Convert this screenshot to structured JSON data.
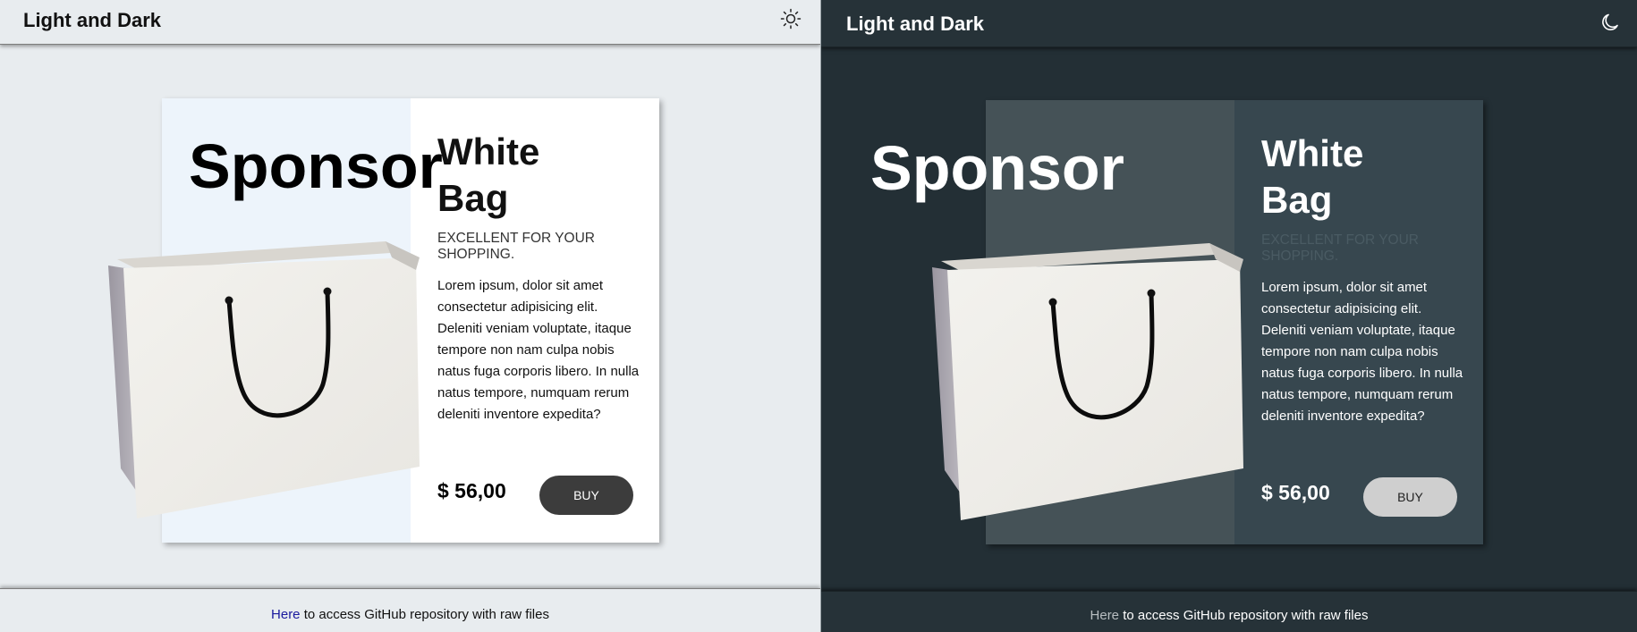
{
  "header": {
    "title": "Light and Dark"
  },
  "card": {
    "sponsor": "Sponsor",
    "product_name_line1": "White",
    "product_name_line2": "Bag",
    "tagline": "Excellent for your shopping.",
    "description": "Lorem ipsum, dolor sit amet consectetur adipisicing elit. Deleniti veniam voluptate, itaque tempore non nam culpa nobis natus fuga corporis libero. In nulla natus tempore, numquam rerum deleniti inventore expedita?",
    "price": "$ 56,00",
    "buy_label": "BUY"
  },
  "footer": {
    "link_text": "Here",
    "text": " to access GitHub repository with raw files"
  },
  "icons": {
    "light_theme": "sun-icon",
    "dark_theme": "moon-icon"
  },
  "colors": {
    "light_background": "#e8ecef",
    "dark_background": "#232f35",
    "light_button": "#3c3c3c",
    "dark_button": "#cfcfcf",
    "light_link": "#1a1a9e",
    "dark_link": "#b8bec1"
  }
}
